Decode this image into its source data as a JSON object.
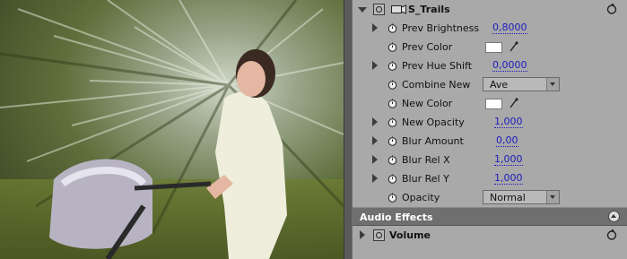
{
  "video_effects": {
    "effect_name": "S_Trails",
    "params": [
      {
        "label": "Prev Brightness",
        "value": "0,8000",
        "expandable": true
      },
      {
        "label": "Prev Color",
        "expandable": false,
        "color": "#ffffff"
      },
      {
        "label": "Prev Hue Shift",
        "value": "0,0000",
        "expandable": true
      },
      {
        "label": "Combine New",
        "expandable": false,
        "dropdown": "Ave"
      },
      {
        "label": "New Color",
        "expandable": false,
        "color": "#ffffff"
      },
      {
        "label": "New Opacity",
        "value": "1,000",
        "expandable": true
      },
      {
        "label": "Blur Amount",
        "value": "0,00",
        "expandable": true
      },
      {
        "label": "Blur Rel X",
        "value": "1,000",
        "expandable": true
      },
      {
        "label": "Blur Rel Y",
        "value": "1,000",
        "expandable": true
      },
      {
        "label": "Opacity",
        "expandable": false,
        "dropdown": "Normal"
      }
    ]
  },
  "audio_effects": {
    "section_title": "Audio Effects",
    "effect_name": "Volume"
  },
  "colors": {
    "panel_bg": "#a9a9a9",
    "value_link": "#1d1dbd",
    "section_header": "#6f6f6f"
  }
}
